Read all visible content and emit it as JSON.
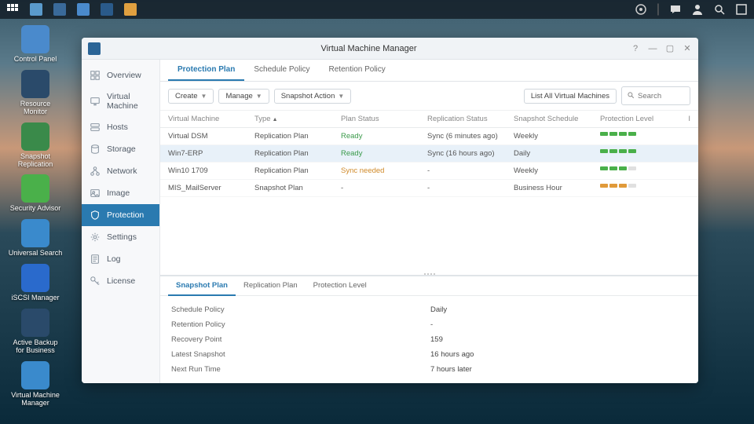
{
  "taskbar": {
    "left_icons": [
      "grid-icon",
      "app1-icon",
      "app2-icon",
      "app3-icon",
      "app4-icon",
      "app5-icon"
    ],
    "right_icons": [
      "health-icon",
      "chat-icon",
      "user-icon",
      "search-icon",
      "expand-icon"
    ]
  },
  "desktop": [
    {
      "label": "Control Panel",
      "color": "#4a8acc"
    },
    {
      "label": "Resource Monitor",
      "color": "#2a4a6a"
    },
    {
      "label": "Snapshot Replication",
      "color": "#3a8a4a"
    },
    {
      "label": "Security Advisor",
      "color": "#4ab04a"
    },
    {
      "label": "Universal Search",
      "color": "#3a8acc"
    },
    {
      "label": "iSCSI Manager",
      "color": "#2a6acc"
    },
    {
      "label": "Active Backup for Business",
      "color": "#2a4a6a"
    },
    {
      "label": "Virtual Machine Manager",
      "color": "#3a8acc"
    }
  ],
  "window": {
    "title": "Virtual Machine Manager",
    "sidebar": [
      {
        "key": "overview",
        "label": "Overview",
        "icon": "dashboard"
      },
      {
        "key": "vm",
        "label": "Virtual Machine",
        "icon": "monitor"
      },
      {
        "key": "hosts",
        "label": "Hosts",
        "icon": "server"
      },
      {
        "key": "storage",
        "label": "Storage",
        "icon": "disk"
      },
      {
        "key": "network",
        "label": "Network",
        "icon": "network"
      },
      {
        "key": "image",
        "label": "Image",
        "icon": "image"
      },
      {
        "key": "protection",
        "label": "Protection",
        "icon": "shield"
      },
      {
        "key": "settings",
        "label": "Settings",
        "icon": "gear"
      },
      {
        "key": "log",
        "label": "Log",
        "icon": "log"
      },
      {
        "key": "license",
        "label": "License",
        "icon": "key"
      }
    ],
    "active_sidebar": "protection",
    "subtabs": [
      "Protection Plan",
      "Schedule Policy",
      "Retention Policy"
    ],
    "active_subtab": 0,
    "toolbar": {
      "create": "Create",
      "manage": "Manage",
      "snapshot": "Snapshot Action",
      "list_all": "List All Virtual Machines",
      "search_placeholder": "Search"
    },
    "columns": {
      "vm": "Virtual Machine",
      "type": "Type",
      "plan": "Plan Status",
      "rep": "Replication Status",
      "sched": "Snapshot Schedule",
      "prot": "Protection Level",
      "i": "I"
    },
    "rows": [
      {
        "vm": "Virtual DSM",
        "type": "Replication Plan",
        "plan": "Ready",
        "plan_cls": "status-ready",
        "rep": "Sync (6 minutes ago)",
        "sched": "Weekly",
        "bars": [
          "g",
          "g",
          "g",
          "g"
        ]
      },
      {
        "vm": "Win7-ERP",
        "type": "Replication Plan",
        "plan": "Ready",
        "plan_cls": "status-ready",
        "rep": "Sync (16 hours ago)",
        "sched": "Daily",
        "bars": [
          "g",
          "g",
          "g",
          "g"
        ],
        "selected": true
      },
      {
        "vm": "Win10 1709",
        "type": "Replication Plan",
        "plan": "Sync needed",
        "plan_cls": "status-sync",
        "rep": "-",
        "sched": "Weekly",
        "bars": [
          "g",
          "g",
          "g",
          "e"
        ]
      },
      {
        "vm": "MIS_MailServer",
        "type": "Snapshot Plan",
        "plan": "-",
        "plan_cls": "",
        "rep": "-",
        "sched": "Business Hour",
        "bars": [
          "o",
          "o",
          "o",
          "e"
        ]
      }
    ],
    "detail": {
      "tabs": [
        "Snapshot Plan",
        "Replication Plan",
        "Protection Level"
      ],
      "active": 0,
      "rows": [
        {
          "label": "Schedule Policy",
          "value": "Daily"
        },
        {
          "label": "Retention Policy",
          "value": "-"
        },
        {
          "label": "Recovery Point",
          "value": "159"
        },
        {
          "label": "Latest Snapshot",
          "value": "16 hours ago"
        },
        {
          "label": "Next Run Time",
          "value": "7 hours later"
        }
      ]
    }
  }
}
